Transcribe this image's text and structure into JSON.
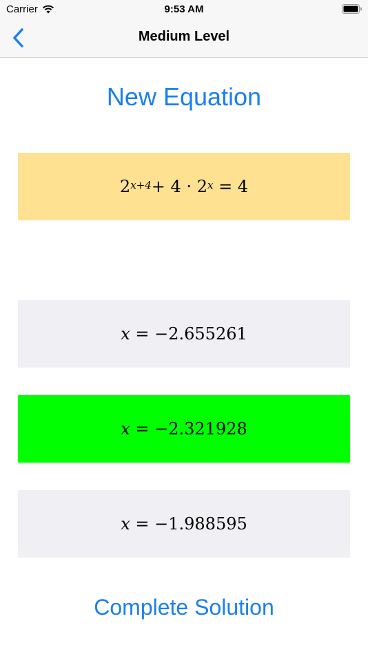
{
  "status_bar": {
    "carrier": "Carrier",
    "time": "9:53 AM"
  },
  "nav": {
    "title": "Medium Level"
  },
  "main": {
    "new_equation_label": "New Equation",
    "equation": {
      "base1": "2",
      "exp1": "x+4",
      "plus": "+ 4 · ",
      "base2": "2",
      "exp2": "x",
      "rhs": " = 4"
    },
    "answers": [
      {
        "var": "x",
        "rest": " = −2.655261",
        "color": "#efeff4"
      },
      {
        "var": "x",
        "rest": " = −2.321928",
        "color": "#00ff00"
      },
      {
        "var": "x",
        "rest": " = −1.988595",
        "color": "#efeff4"
      }
    ],
    "complete_solution_label": "Complete Solution"
  },
  "colors": {
    "accent": "#1a7ff0",
    "equation_bg": "#ffe192",
    "correct": "#00ff00",
    "neutral": "#efeff4"
  },
  "icons": [
    "wifi-icon",
    "battery-icon",
    "chevron-left-icon"
  ]
}
